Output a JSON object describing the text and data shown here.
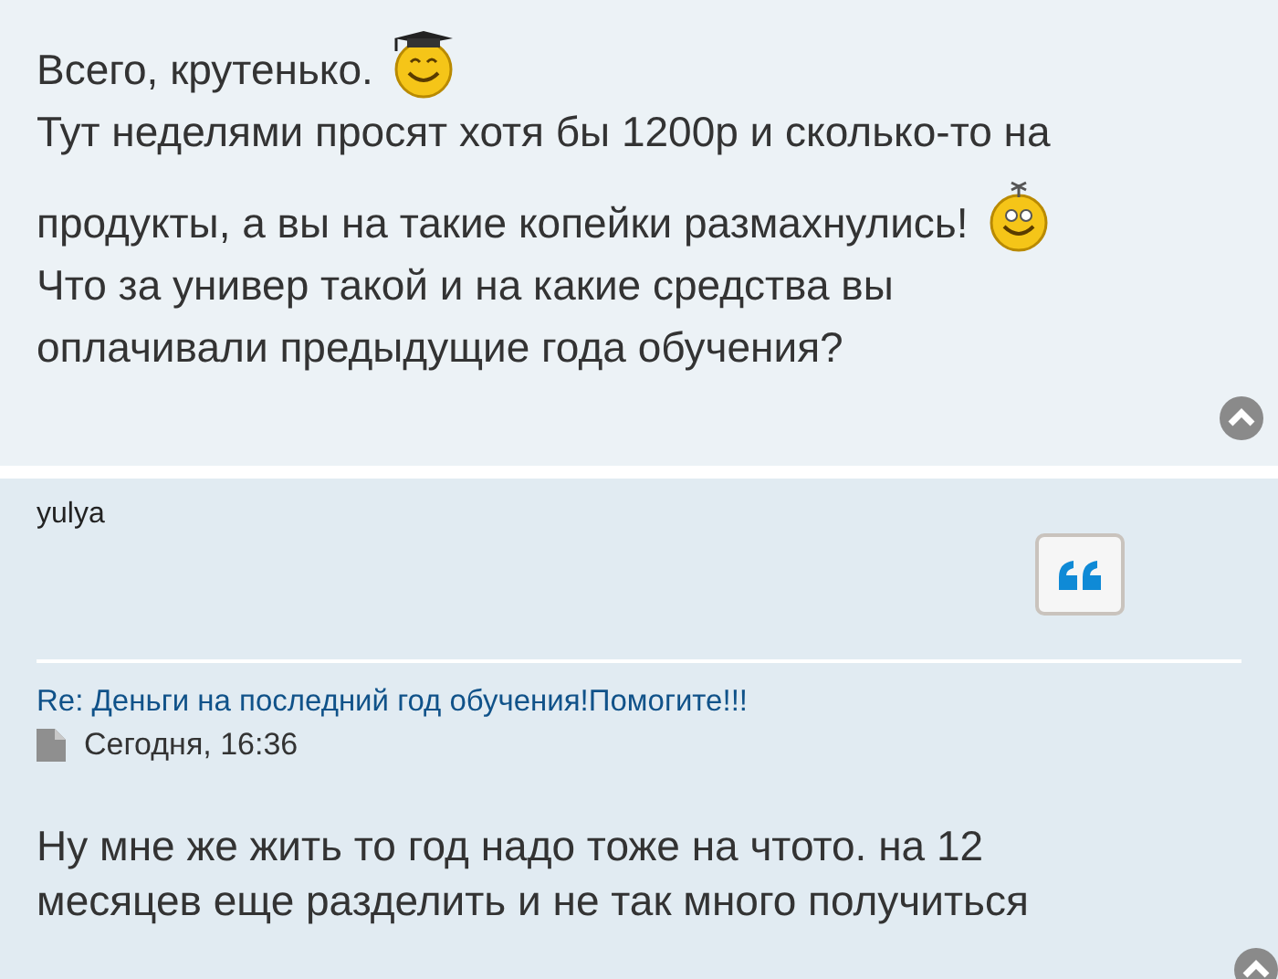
{
  "posts": [
    {
      "kind": "body_only",
      "lines": [
        {
          "text": "Всего, крутенько.",
          "emoticon": {
            "kind": "graduate"
          }
        },
        {
          "text": "Тут неделями просят хотя бы 1200р и сколько-то на"
        },
        {
          "text": "продукты, а вы на такие копейки размахнулись!",
          "emoticon": {
            "kind": "antenna"
          }
        },
        {
          "text": "Что за универ такой и на какие средства вы"
        },
        {
          "text": "оплачивали предыдущие года обучения?"
        }
      ]
    },
    {
      "kind": "full",
      "author": "yulya",
      "title": "Re: Деньги на последний год обучения!Помогите!!!",
      "date": "Сегодня, 16:36",
      "lines": [
        {
          "text": "Ну мне же жить то год надо тоже на чтото. на 12"
        },
        {
          "text": "месяцев еще разделить и не так много получиться"
        }
      ]
    }
  ]
}
